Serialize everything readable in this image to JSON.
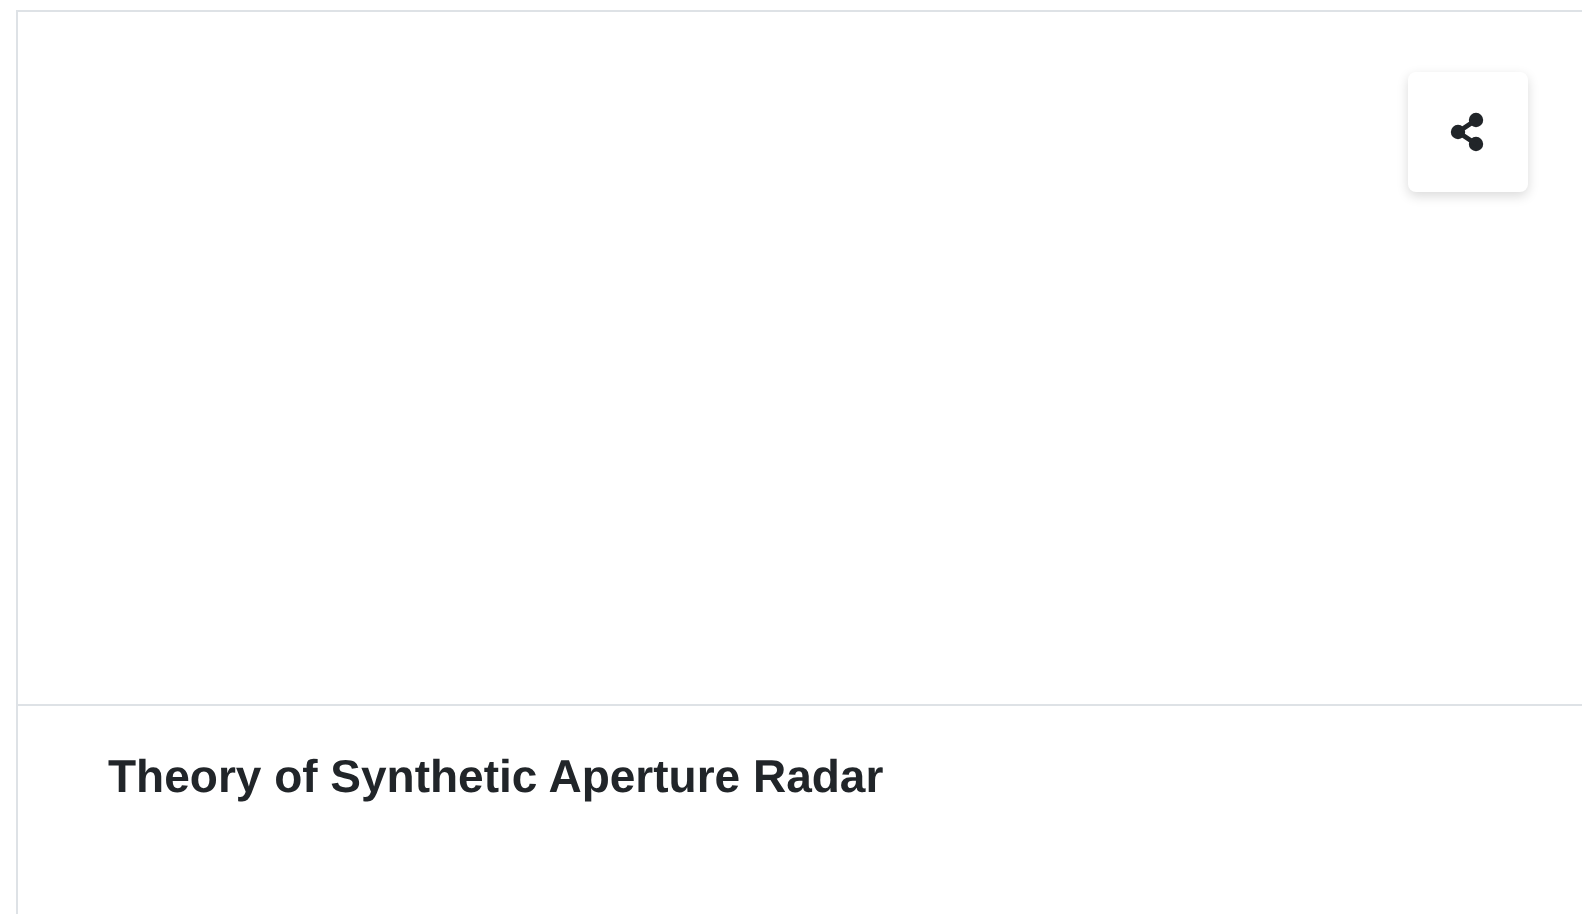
{
  "card": {
    "title": "Theory of Synthetic Aperture Radar"
  }
}
